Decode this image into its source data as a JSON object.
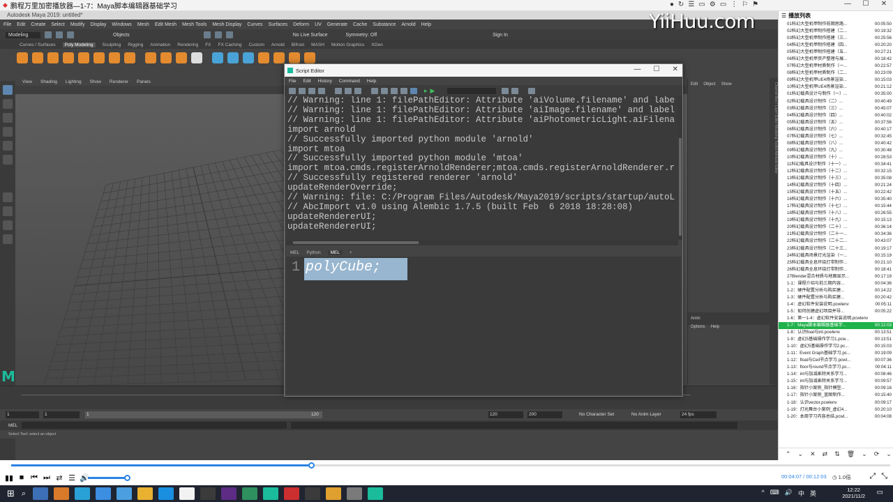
{
  "player": {
    "title": "鹏程万里加密播放器—1-7：Maya脚本编辑器基础学习",
    "window_controls": [
      "—",
      "☐",
      "✕"
    ],
    "top_icons": [
      "●",
      "↻",
      "☰",
      "▭",
      "⚙",
      "▭",
      "⋮",
      "⚐",
      "⚑"
    ]
  },
  "watermark": "YiiHuu.com",
  "maya": {
    "title": "Autodesk Maya 2019: untitled*",
    "menu": [
      "File",
      "Edit",
      "Create",
      "Select",
      "Modify",
      "Display",
      "Windows",
      "Mesh",
      "Edit Mesh",
      "Mesh Tools",
      "Mesh Display",
      "Curves",
      "Surfaces",
      "Deform",
      "UV",
      "Generate",
      "Cache",
      "Substance",
      "Arnold",
      "Help"
    ],
    "mode": "Modeling",
    "objects_label": "Objects",
    "live_surface": "No Live Surface",
    "symmetry": "Symmetry: Off",
    "sign_in": "Sign In",
    "shelf_tabs": [
      "Curves / Surfaces",
      "Poly Modeling",
      "Sculpting",
      "Rigging",
      "Animation",
      "Rendering",
      "FX",
      "FX Caching",
      "Custom",
      "Arnold",
      "Bifrost",
      "MASH",
      "Motion Graphics",
      "XGen"
    ],
    "active_shelf": "Poly Modeling",
    "viewport_menu": [
      "View",
      "Shading",
      "Lighting",
      "Show",
      "Renderer",
      "Panels"
    ],
    "right_panel_tabs": [
      "Edit",
      "Object",
      "Show"
    ],
    "right_panel_lower": [
      "Anim",
      "Options",
      "Help"
    ],
    "channel_strip": "Channel Box / Layer Editor   Modeling Toolkit   Attribute Editor",
    "range": {
      "start": "1",
      "current": "1",
      "slider_start": "1",
      "slider_end": "120",
      "end": "120",
      "max": "200",
      "char_set": "No Character Set",
      "anim_layer": "No Anim Layer",
      "fps": "24 fps"
    },
    "mel_label": "MEL",
    "help_line": "Select Tool: select an object"
  },
  "script_editor": {
    "title": "Script Editor",
    "menu": [
      "File",
      "Edit",
      "History",
      "Command",
      "Help"
    ],
    "history": [
      "// Warning: line 1: filePathEditor: Attribute 'aiVolume.filename' and labe",
      "// Warning: line 1: filePathEditor: Attribute 'aiImage.filename' and label",
      "// Warning: line 1: filePathEditor: Attribute 'aiPhotometricLight.aiFilena",
      "import arnold",
      "// Successfully imported python module 'arnold'",
      "import mtoa",
      "// Successfully imported python module 'mtoa'",
      "import mtoa.cmds.registerArnoldRenderer;mtoa.cmds.registerArnoldRenderer.r",
      "// Successfully registered renderer 'arnold'",
      "updateRenderOverride;",
      "// Warning: file: C:/Program Files/Autodesk/Maya2019/scripts/startup/autoL",
      "// AbcImport v1.0 using Alembic 1.7.5 (built Feb  6 2018 18:28:08)",
      "updateRendererUI;",
      "updateRendererUI;"
    ],
    "tabs": [
      "MEL",
      "Python",
      "MEL",
      "+"
    ],
    "active_tab_index": 2,
    "line_number": "1",
    "code": "polyCube;"
  },
  "playlist": {
    "header": "播放列表",
    "items": [
      {
        "name": "01科幻大型机甲制作前期思路...",
        "time": "00:05:50"
      },
      {
        "name": "02科幻大型机甲制作搭建（二...",
        "time": "00:19:32"
      },
      {
        "name": "03科幻大型机甲制作搭建（三...",
        "time": "00:25:56"
      },
      {
        "name": "04科幻大型机甲制作搭建（四...",
        "time": "00:20:20"
      },
      {
        "name": "05科幻大型机甲制作搭建（五...",
        "time": "00:27:21"
      },
      {
        "name": "06科幻大型机甲资产整理与展...",
        "time": "00:18:42"
      },
      {
        "name": "07科幻大型机甲材质制作（一...",
        "time": "00:22:57"
      },
      {
        "name": "08科幻大型机甲材质制作（二...",
        "time": "00:23:09"
      },
      {
        "name": "09科幻大型机甲UE4场景渲染...",
        "time": "00:15:03"
      },
      {
        "name": "10科幻大型机甲UE4场景渲染...",
        "time": "00:21:12"
      },
      {
        "name": "01科幻载具设计与制作（一）...",
        "time": "00:35:00"
      },
      {
        "name": "02科幻载具设计制作（二）...",
        "time": "00:40:49"
      },
      {
        "name": "03科幻载具设计制作（三）...",
        "time": "00:45:07"
      },
      {
        "name": "04科幻载具设计制作（四）...",
        "time": "00:40:02"
      },
      {
        "name": "05科幻载具设计制作（五）...",
        "time": "00:37:56"
      },
      {
        "name": "06科幻载具设计制作（六）...",
        "time": "00:40:17"
      },
      {
        "name": "07科幻载具设计制作（七）...",
        "time": "00:32:45"
      },
      {
        "name": "08科幻载具设计制作（八）...",
        "time": "00:40:42"
      },
      {
        "name": "09科幻载具设计制作（九）...",
        "time": "00:30:48"
      },
      {
        "name": "10科幻载具设计制作（十）...",
        "time": "00:28:53"
      },
      {
        "name": "11科幻载具设计制作（十一）...",
        "time": "00:34:41"
      },
      {
        "name": "12科幻载具设计制作（十二）...",
        "time": "00:32:15"
      },
      {
        "name": "13科幻载具设计制作（十三）...",
        "time": "00:35:08"
      },
      {
        "name": "14科幻载具设计制作（十四）...",
        "time": "00:21:24"
      },
      {
        "name": "15科幻载具设计制作（十五）...",
        "time": "00:22:42"
      },
      {
        "name": "16科幻载具设计制作（十六）...",
        "time": "00:35:40"
      },
      {
        "name": "17科幻载具设计制作（十七）...",
        "time": "00:15:44"
      },
      {
        "name": "18科幻载具设计制作（十八）...",
        "time": "00:26:55"
      },
      {
        "name": "19科幻载具设计制作（十九）...",
        "time": "00:15:13"
      },
      {
        "name": "20科幻载具设计制作（二十）...",
        "time": "00:36:14"
      },
      {
        "name": "21科幻载具设计制作（二十一...",
        "time": "00:34:36"
      },
      {
        "name": "22科幻载具设计制作（二十二...",
        "time": "00:43:07"
      },
      {
        "name": "23科幻载具设计制作（二十三...",
        "time": "00:19:17"
      },
      {
        "name": "24科幻载具场景灯光渲染（一...",
        "time": "00:15:19"
      },
      {
        "name": "25科幻载具全息环绕灯带制作...",
        "time": "00:21:10"
      },
      {
        "name": "26科幻载具全息环绕灯带制作...",
        "time": "00:18:41"
      },
      {
        "name": "27Blender混合材质与地面显示...",
        "time": "00:17:19"
      },
      {
        "name": "1-1：课程介绍与前三期内容...",
        "time": "00:04:36"
      },
      {
        "name": "1-2：硬件配置分析与购买建...",
        "time": "00:14:22"
      },
      {
        "name": "1-3：硬件配置分析与购买建...",
        "time": "00:20:42"
      },
      {
        "name": "1-4：虚幻软件安装说明.pcwlenv",
        "time": "00:05:11"
      },
      {
        "name": "1-5：如何创建虚幻项目并导...",
        "time": "00:05:22"
      },
      {
        "name": "1-6：第一1-4：虚幻软件安装说明.pcwlenv",
        "time": ""
      },
      {
        "name": "1-7：Maya脚本编辑器基础学...",
        "time": "00:12:03"
      },
      {
        "name": "1-8：认识float与int.pcwlenv",
        "time": "00:13:51"
      },
      {
        "name": "1-9：虚幻5基础操作学习1.pcw...",
        "time": "00:13:51"
      },
      {
        "name": "1-10：虚幻5基础操作学习2.pc...",
        "time": "00:15:03"
      },
      {
        "name": "1-11：Event Graph基础学习.pc...",
        "time": "00:19:09"
      },
      {
        "name": "1-12：float与Ceil节点学习.pcwl...",
        "time": "00:07:36"
      },
      {
        "name": "1-13：floor与round节点学习.pc...",
        "time": "00:04:11"
      },
      {
        "name": "1-14：int与加减乘除关系学习...",
        "time": "00:08:46"
      },
      {
        "name": "1-15：int与加减乘除关系学习...",
        "time": "00:09:57"
      },
      {
        "name": "1-16：指针小案例_指针模型...",
        "time": "00:09:16"
      },
      {
        "name": "1-17：指针小案例_蓝图制作...",
        "time": "00:15:40"
      },
      {
        "name": "1-18：认识vector.pcwlenv",
        "time": "00:09:17"
      },
      {
        "name": "1-19：灯光舞台小案例_虚幻4...",
        "time": "00:20:10"
      },
      {
        "name": "1-20：本周学习内容总结.pcwl...",
        "time": "00:04:08"
      }
    ],
    "active_index": 43,
    "bottom_icons": [
      "⌃",
      "⌄",
      "✕",
      "⇄",
      "⇅",
      "🗑",
      "⌄",
      "⟳",
      "⌄"
    ]
  },
  "playback": {
    "current": "00:04:07",
    "separator": " / ",
    "total": "00:12:03",
    "progress": 0.342,
    "volume": 0.92,
    "speed": "1.0倍",
    "controls": [
      "▮▮",
      "■",
      "⏮",
      "⏭",
      "⇄",
      "☰",
      "🔊"
    ],
    "right_controls": [
      "⤢",
      "⤡"
    ]
  },
  "taskbar": {
    "time": "12:22",
    "date": "2021/11/2",
    "tray": [
      "^",
      "⌨",
      "🔊",
      "中",
      "英"
    ],
    "apps": [
      "#3c6fb5",
      "#d97a2b",
      "#2aa1d6",
      "#3c8ee0",
      "#4b9fe0",
      "#e9b130",
      "#1a8fe0",
      "#f2f2f2",
      "#3b3b3b",
      "#5d2c85",
      "#2f8f5e",
      "#1abc9c",
      "#cc2f2f",
      "#3b3b3b",
      "#e0a030",
      "#7a7a7a",
      "#1abc9c"
    ]
  }
}
